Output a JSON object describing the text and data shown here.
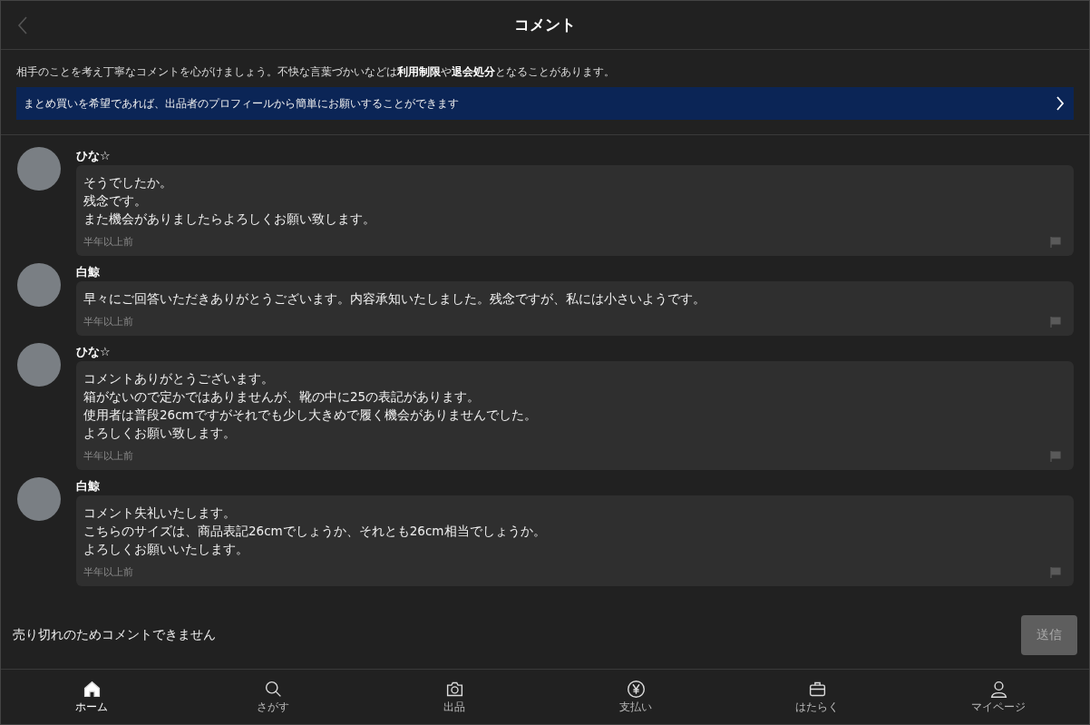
{
  "header": {
    "title": "コメント"
  },
  "notice": {
    "text": "相手のことを考え丁寧なコメントを心がけましょう。不快な言葉づかいなどは**利用制限**や**退会処分**となることがあります。",
    "banner": "まとめ買いを希望であれば、出品者のプロフィールから簡単にお願いすることができます"
  },
  "comments": [
    {
      "user": "ひな☆",
      "lines": [
        "そうでしたか。",
        "残念です。",
        "また機会がありましたらよろしくお願い致します。"
      ],
      "time": "半年以上前"
    },
    {
      "user": "白鯨",
      "lines": [
        "早々にご回答いただきありがとうございます。内容承知いたしました。残念ですが、私には小さいようです。"
      ],
      "time": "半年以上前"
    },
    {
      "user": "ひな☆",
      "lines": [
        "コメントありがとうございます。",
        "箱がないので定かではありませんが、靴の中に25の表記があります。",
        "使用者は普段26cmですがそれでも少し大きめで履く機会がありませんでした。",
        "よろしくお願い致します。"
      ],
      "time": "半年以上前"
    },
    {
      "user": "白鯨",
      "lines": [
        "コメント失礼いたします。",
        "こちらのサイズは、商品表記26cmでしょうか、それとも26cm相当でしょうか。",
        "よろしくお願いいたします。"
      ],
      "time": "半年以上前"
    }
  ],
  "composer": {
    "message": "売り切れのためコメントできません",
    "send": "送信",
    "disabled": true
  },
  "tabs": [
    {
      "label": "ホーム",
      "kind": "home",
      "selected": true
    },
    {
      "label": "さがす",
      "kind": "search",
      "selected": false
    },
    {
      "label": "出品",
      "kind": "camera",
      "selected": false
    },
    {
      "label": "支払い",
      "kind": "payment",
      "selected": false
    },
    {
      "label": "はたらく",
      "kind": "work",
      "selected": false
    },
    {
      "label": "マイページ",
      "kind": "profile",
      "selected": false
    }
  ]
}
